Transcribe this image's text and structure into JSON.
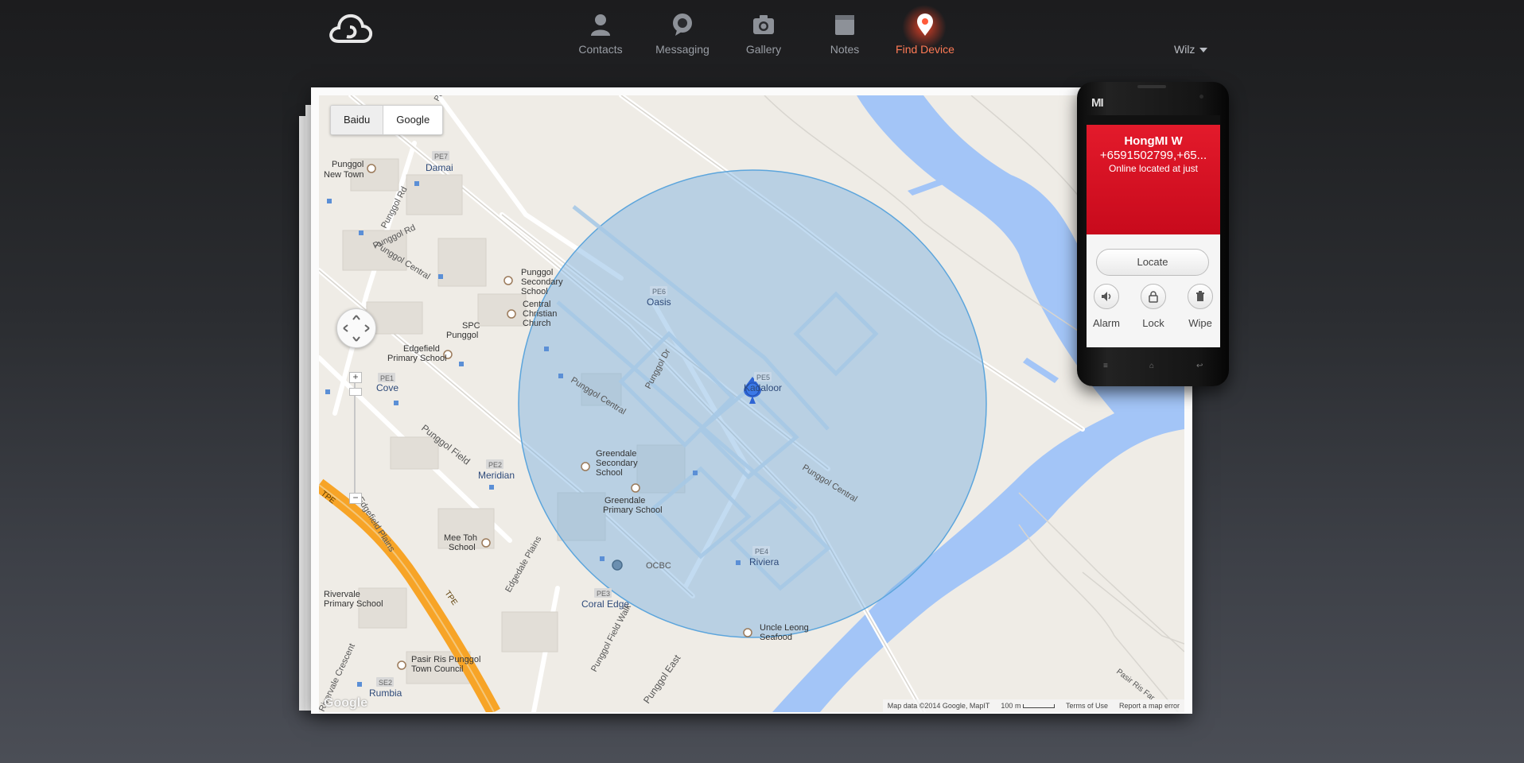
{
  "nav": {
    "items": [
      {
        "label": "Contacts",
        "icon": "contacts-icon"
      },
      {
        "label": "Messaging",
        "icon": "messaging-icon"
      },
      {
        "label": "Gallery",
        "icon": "gallery-icon"
      },
      {
        "label": "Notes",
        "icon": "notes-icon"
      },
      {
        "label": "Find Device",
        "icon": "find-device-icon",
        "active": true
      }
    ],
    "user": "Wilz"
  },
  "map": {
    "tabs": [
      "Baidu",
      "Google"
    ],
    "attribution": {
      "data": "Map data ©2014 Google, MapIT",
      "scale": "100 m",
      "terms": "Terms of Use",
      "report": "Report a map error"
    },
    "logo": "Google",
    "labels": {
      "punggol_new_town": [
        "Punggol",
        "New Town"
      ],
      "damai_code": "PE7",
      "damai": "Damai",
      "punggol_rd": "Punggol Rd",
      "punggol_central": "Punggol Central",
      "punggol_secondary": [
        "Punggol",
        "Secondary",
        "School"
      ],
      "central_christian": [
        "Central",
        "Christian",
        "Church"
      ],
      "spc": [
        "SPC",
        "Punggol"
      ],
      "edgefield_primary": [
        "Edgefield",
        "Primary School"
      ],
      "cove_code": "PE1",
      "cove": "Cove",
      "oasis_code": "PE6",
      "oasis": "Oasis",
      "punggol_dr": "Punggol Dr",
      "kadaloor_code": "PE5",
      "kadaloor": "Kadaloor",
      "punggol_field": "Punggol Field",
      "meridian_code": "PE2",
      "meridian": "Meridian",
      "greendale_secondary": [
        "Greendale",
        "Secondary",
        "School"
      ],
      "greendale_primary": [
        "Greendale",
        "Primary School"
      ],
      "edgefield_plains": "Edgefield Plains",
      "mee_toh": [
        "Mee Toh",
        "School"
      ],
      "ocbc": "OCBC",
      "riviera_code": "PE4",
      "riviera": "Riviera",
      "edgedale_plains": "Edgedale Plains",
      "coral_edge_code": "PE3",
      "coral_edge": "Coral Edge",
      "uncle_leong": [
        "Uncle Leong",
        "Seafood"
      ],
      "rivervale_primary": [
        "Rivervale",
        "Primary School"
      ],
      "pasir_ris_punggol": [
        "Pasir Ris Punggol",
        "Town Council"
      ],
      "rumbia_code": "SE2",
      "rumbia": "Rumbia",
      "tpe": "TPE",
      "punggol_field_walk": "Punggol Field Walk",
      "punggol_east": "Punggol East",
      "rivervale_crescent": "Rivervale Crescent",
      "pasir_ris_far": "Pasir Ris Far",
      "punggol_top": "Punggo"
    }
  },
  "device": {
    "brand": "MI",
    "name": "HongMI W",
    "phone": "+6591502799,+65...",
    "status": "Online located at just",
    "locate_label": "Locate",
    "actions": [
      {
        "label": "Alarm",
        "icon": "speaker-icon"
      },
      {
        "label": "Lock",
        "icon": "lock-icon"
      },
      {
        "label": "Wipe",
        "icon": "trash-icon"
      }
    ]
  },
  "colors": {
    "accent": "#ff7a55",
    "device_panel": "#d8101f",
    "accuracy_circle": "#9ec3e6",
    "water": "#a3c5f7",
    "expressway": "#f7a427"
  }
}
